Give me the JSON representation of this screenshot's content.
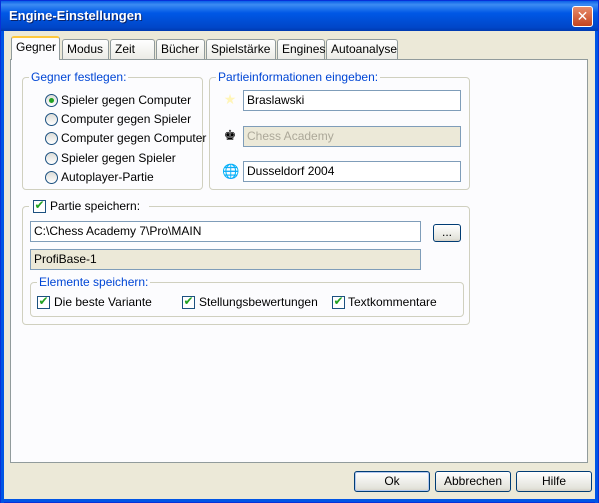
{
  "window": {
    "title": "Engine-Einstellungen",
    "close_glyph": "✕"
  },
  "tabs": [
    {
      "label": "Gegner",
      "active": true
    },
    {
      "label": "Modus"
    },
    {
      "label": "Zeit"
    },
    {
      "label": "Bücher"
    },
    {
      "label": "Spielstärke"
    },
    {
      "label": "Engines"
    },
    {
      "label": "Autoanalyse"
    }
  ],
  "opponent": {
    "legend": "Gegner festlegen:",
    "options": [
      {
        "label": "Spieler gegen Computer",
        "selected": true
      },
      {
        "label": "Computer gegen Spieler",
        "selected": false
      },
      {
        "label": "Computer gegen Computer",
        "selected": false
      },
      {
        "label": "Spieler gegen Spieler",
        "selected": false
      },
      {
        "label": "Autoplayer-Partie",
        "selected": false
      }
    ]
  },
  "game_info": {
    "legend": "Partieinformationen eingeben:",
    "player": {
      "value": "Braslawski",
      "icon": "star-icon"
    },
    "team": {
      "value": "Chess Academy",
      "icon": "king-icon",
      "disabled": true
    },
    "location": {
      "value": "Dusseldorf 2004",
      "icon": "globe-icon"
    }
  },
  "save": {
    "label": "Partie speichern:",
    "checked": true,
    "path": "C:\\Chess Academy 7\\Pro\\MAIN",
    "browse_label": "...",
    "database": "ProfiBase-1",
    "elements_legend": "Elemente speichern:",
    "elements": [
      {
        "label": "Die beste Variante",
        "checked": true
      },
      {
        "label": "Stellungsbewertungen",
        "checked": true
      },
      {
        "label": "Textkommentare",
        "checked": true
      }
    ]
  },
  "buttons": {
    "ok": "Ok",
    "cancel": "Abbrechen",
    "help": "Hilfe"
  },
  "colors": {
    "title_bar": "#0058E6",
    "legend_text": "#0046D5",
    "tab_highlight": "#FFC83C",
    "check_color": "#21A121"
  }
}
